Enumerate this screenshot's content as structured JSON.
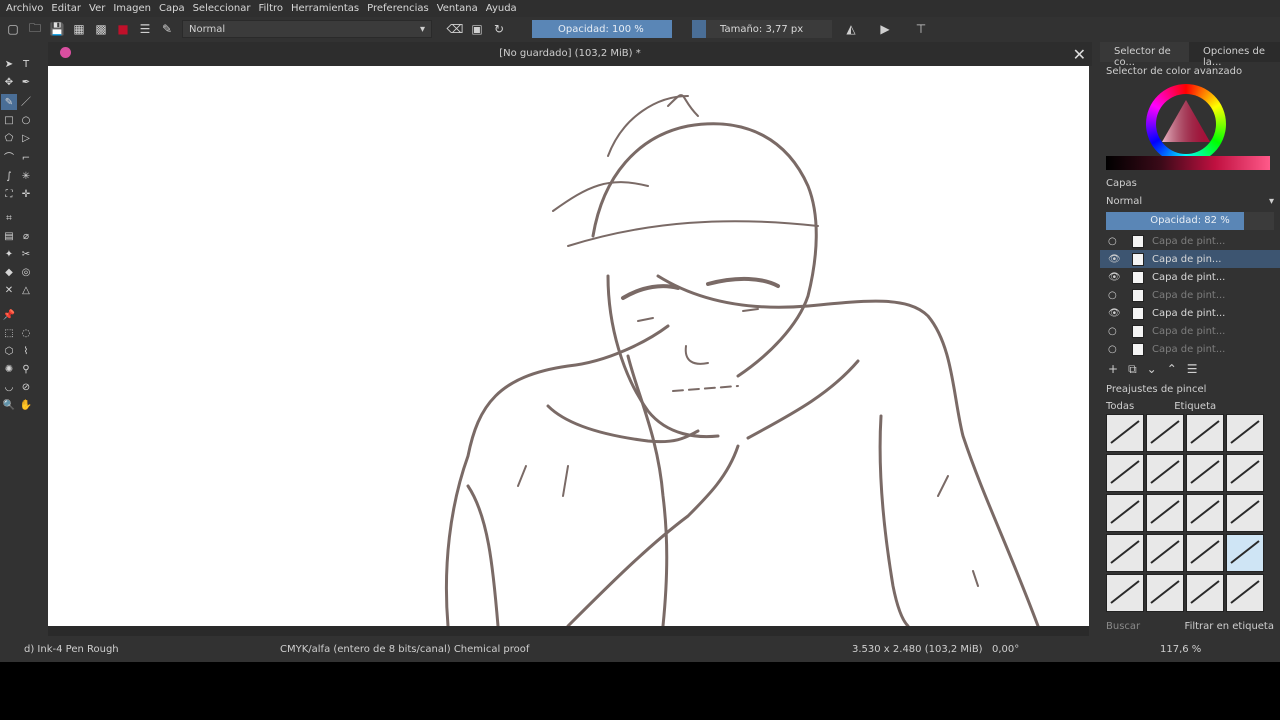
{
  "menu": [
    "Archivo",
    "Editar",
    "Ver",
    "Imagen",
    "Capa",
    "Seleccionar",
    "Filtro",
    "Herramientas",
    "Preferencias",
    "Ventana",
    "Ayuda"
  ],
  "toolbar": {
    "blend_mode": "Normal",
    "opacity_label": "Opacidad: 100 %",
    "opacity_value": 1.0,
    "size_label": "Tamaño: 3,77 px",
    "size_value": 0.1
  },
  "document": {
    "title": "[No guardado]  (103,2 MiB) *"
  },
  "right_panel": {
    "tabs": [
      "Selector de co...",
      "Opciones de la..."
    ],
    "color_title": "Selector de color avanzado",
    "layers_title": "Capas",
    "layers_blend": "Normal",
    "layers_opacity_label": "Opacidad:  82 %",
    "layers_opacity_value": 0.82,
    "layers": [
      {
        "label": "Capa de pint...",
        "visible": false,
        "selected": false
      },
      {
        "label": "Capa de pin...",
        "visible": true,
        "selected": true
      },
      {
        "label": "Capa de pint...",
        "visible": true,
        "selected": false
      },
      {
        "label": "Capa de pint...",
        "visible": false,
        "selected": false
      },
      {
        "label": "Capa de pint...",
        "visible": true,
        "selected": false
      },
      {
        "label": "Capa de pint...",
        "visible": false,
        "selected": false
      },
      {
        "label": "Capa de pint...",
        "visible": false,
        "selected": false
      }
    ],
    "brush_title": "Preajustes de pincel",
    "brush_filter": "Todas",
    "brush_tag": "Etiqueta",
    "search_placeholder": "Buscar",
    "filter_tag_label": "Filtrar en etiqueta"
  },
  "status": {
    "brush": "d) Ink-4 Pen Rough",
    "colorspace": "CMYK/alfa (entero de 8 bits/canal)  Chemical proof",
    "dims": "3.530 x 2.480 (103,2 MiB)",
    "rotation": "0,00°",
    "zoom": "117,6 %"
  },
  "colors": {
    "accent": "#4a6e96",
    "bg": "#323232",
    "line": "#7a6a66"
  }
}
